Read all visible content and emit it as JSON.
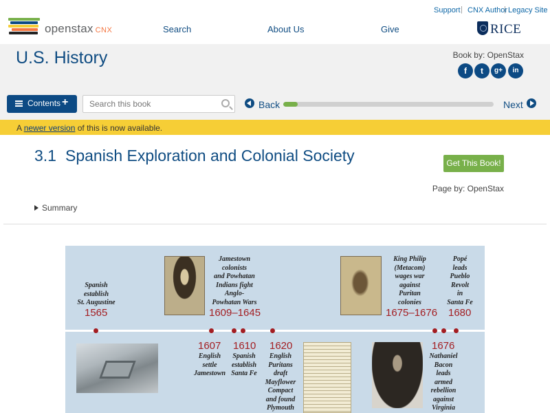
{
  "header": {
    "logo_text": "openstax",
    "logo_cnx": "CNX",
    "utility_links": [
      "Support",
      "CNX Author",
      "Legacy Site"
    ],
    "nav_links": [
      "Search",
      "About Us",
      "Give"
    ],
    "partner_logo": "RICE"
  },
  "book": {
    "title": "U.S. History",
    "author_line": "Book by: OpenStax",
    "social": [
      {
        "name": "facebook-icon",
        "glyph": "f"
      },
      {
        "name": "twitter-icon",
        "glyph": "t"
      },
      {
        "name": "google-plus-icon",
        "glyph": "g+"
      },
      {
        "name": "linkedin-icon",
        "glyph": "in"
      }
    ]
  },
  "toolbar": {
    "contents_label": "Contents",
    "contents_plus": "+",
    "search_placeholder": "Search this book",
    "back_label": "Back",
    "next_label": "Next",
    "progress_fraction": 0.07
  },
  "notice": {
    "prefix": "A ",
    "link_text": "newer version",
    "suffix": " of this is now available."
  },
  "page": {
    "section_number": "3.1",
    "section_title": "Spanish Exploration and Colonial Society",
    "get_book_label": "Get This Book!",
    "page_by": "Page by: OpenStax",
    "summary_label": "Summary"
  },
  "timeline": {
    "events_above": [
      {
        "text": "Spanish\nestablish\nSt. Augustine",
        "year": "1565"
      },
      {
        "text": "Jamestown\ncolonists\nand Powhatan\nIndians fight\nAnglo-\nPowhatan Wars",
        "year": "1609–1645"
      },
      {
        "text": "King Philip\n(Metacom)\nwages war\nagainst\nPuritan\ncolonies",
        "year": "1675–1676"
      },
      {
        "text": "Popé\nleads\nPueblo\nRevolt\nin\nSanta Fe",
        "year": "1680"
      }
    ],
    "events_below": [
      {
        "year": "1607",
        "text": "English\nsettle\nJamestown"
      },
      {
        "year": "1610",
        "text": "Spanish\nestablish\nSanta Fe"
      },
      {
        "year": "1620",
        "text": "English\nPuritans\ndraft\nMayflower\nCompact\nand found\nPlymouth"
      },
      {
        "year": "1676",
        "text": "Nathaniel\nBacon\nleads\narmed\nrebellion\nagainst\nVirginia"
      }
    ],
    "accent_color": "#a31e22",
    "background_color": "#c9dae8"
  }
}
